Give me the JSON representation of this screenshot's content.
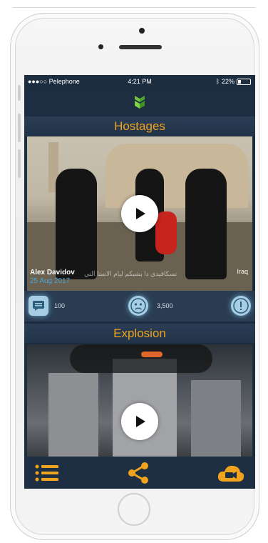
{
  "status_bar": {
    "carrier": "●●●○○ Pelephone",
    "time": "4:21 PM",
    "battery": "22%"
  },
  "feed": [
    {
      "title": "Hostages",
      "author": "Alex Davidov",
      "date": "25 Aug 2017",
      "location": "Iraq",
      "overlay_text": "تسكافيدي دا بشبكم ليام الاستا التي",
      "comments": "100",
      "reactions": "3,500"
    },
    {
      "title": "Explosion"
    }
  ],
  "colors": {
    "accent": "#f0a31d",
    "background": "#1c2d40",
    "date": "#4aa6d8",
    "icon_glow": "#a7cde2"
  },
  "icons": {
    "logo": "green-logo-icon",
    "play": "play-icon",
    "comments": "comment-icon",
    "reaction": "sad-face-icon",
    "report": "exclamation-icon",
    "menu": "list-menu-icon",
    "share": "share-icon",
    "upload": "cloud-camera-icon"
  }
}
